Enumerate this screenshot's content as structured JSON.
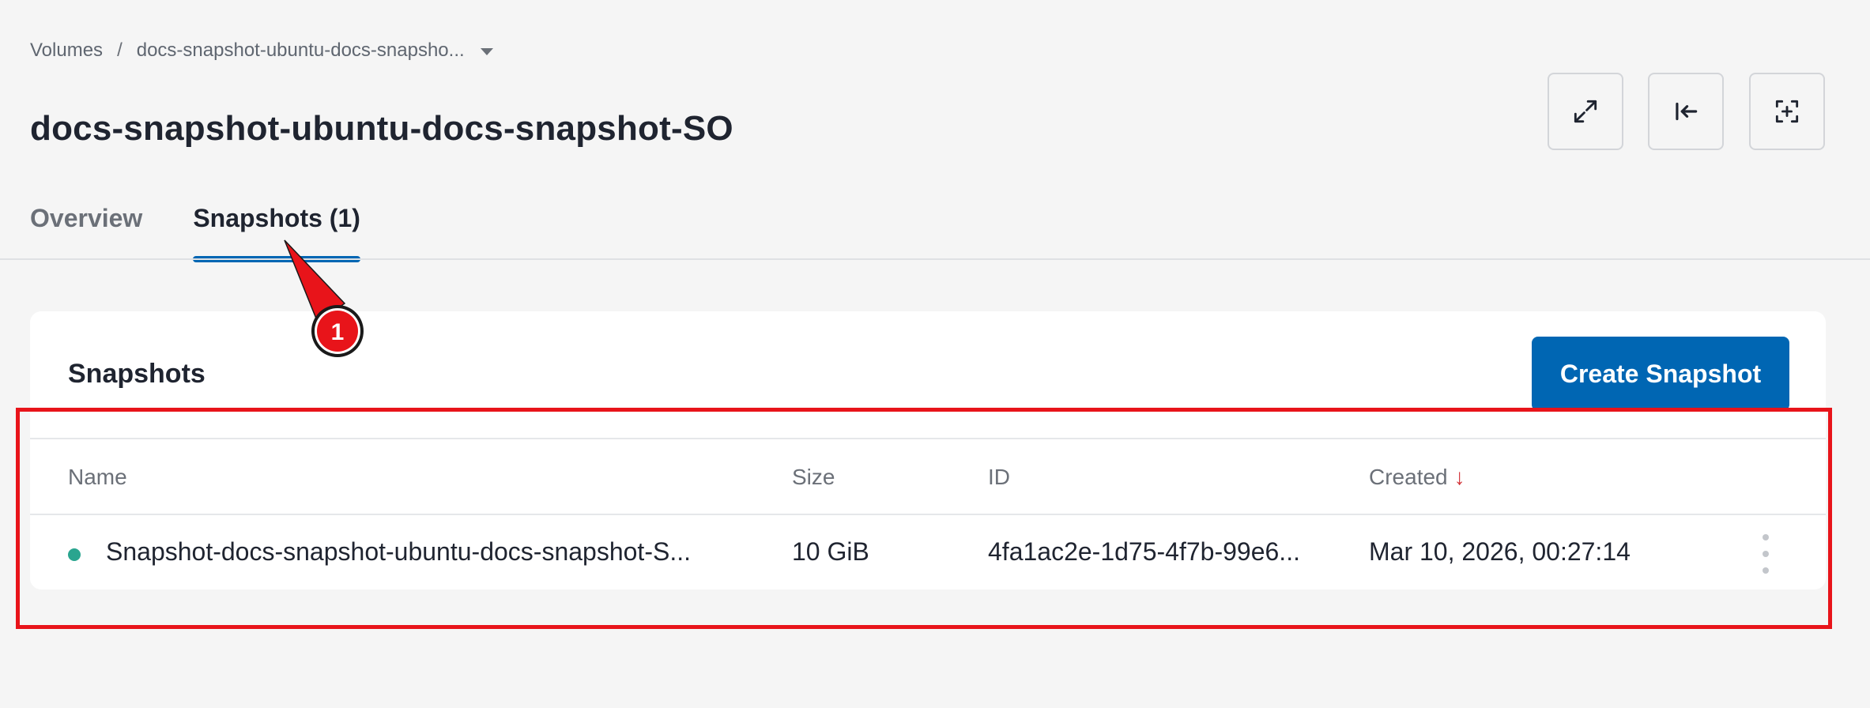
{
  "breadcrumb": {
    "root": "Volumes",
    "separator": "/",
    "current": "docs-snapshot-ubuntu-docs-snapsho..."
  },
  "page_title": "docs-snapshot-ubuntu-docs-snapshot-SO",
  "header_actions": [
    {
      "icon": "expand-icon"
    },
    {
      "icon": "collapse-left-icon"
    },
    {
      "icon": "focus-add-icon"
    }
  ],
  "tabs": [
    {
      "label": "Overview",
      "active": false
    },
    {
      "label": "Snapshots (1)",
      "active": true
    }
  ],
  "snapshots": {
    "title": "Snapshots",
    "create_button": "Create Snapshot",
    "columns": {
      "name": "Name",
      "size": "Size",
      "id": "ID",
      "created": "Created",
      "sort_indicator": "↓"
    },
    "rows": [
      {
        "status_color": "#2aa58f",
        "name": "Snapshot-docs-snapshot-ubuntu-docs-snapshot-S...",
        "size": "10 GiB",
        "id": "4fa1ac2e-1d75-4f7b-99e6...",
        "created": "Mar 10, 2026, 00:27:14"
      }
    ]
  },
  "annotation": {
    "marker": "1",
    "color": "#e8141a"
  },
  "colors": {
    "accent": "#0066b3",
    "background": "#f5f5f5",
    "status_ok": "#2aa58f",
    "annotation": "#e8141a"
  }
}
